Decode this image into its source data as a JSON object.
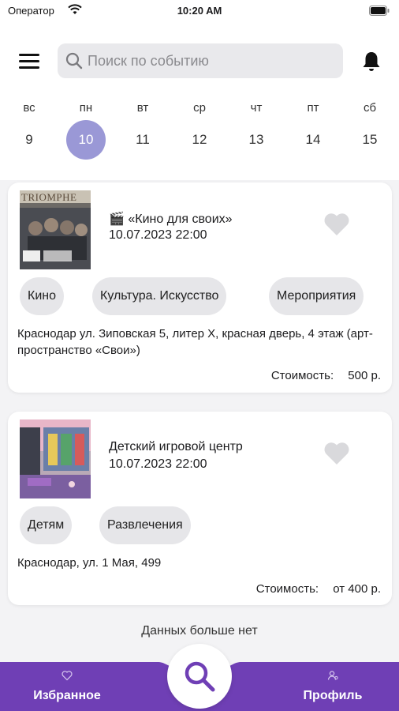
{
  "status_bar": {
    "carrier": "Оператор",
    "time": "10:20 AM"
  },
  "search": {
    "placeholder": "Поиск по событию"
  },
  "week": [
    {
      "name": "вс",
      "num": "9",
      "active": false
    },
    {
      "name": "пн",
      "num": "10",
      "active": true
    },
    {
      "name": "вт",
      "num": "11",
      "active": false
    },
    {
      "name": "ср",
      "num": "12",
      "active": false
    },
    {
      "name": "чт",
      "num": "13",
      "active": false
    },
    {
      "name": "пт",
      "num": "14",
      "active": false
    },
    {
      "name": "сб",
      "num": "15",
      "active": false
    }
  ],
  "events": [
    {
      "title": "🎬 «Кино для своих»",
      "date": "10.07.2023 22:00",
      "thumb_text": "TRIOMPHE",
      "tags": [
        "Кино",
        "Культура. Искусство",
        "Мероприятия"
      ],
      "address": "Краснодар ул. Зиповская 5, литер Х, красная дверь, 4 этаж (арт-пространство «Свои»)",
      "price_label": "Стоимость:",
      "price_value": "500 р."
    },
    {
      "title": "Детский игровой центр",
      "date": "10.07.2023 22:00",
      "tags": [
        "Детям",
        "Развлечения"
      ],
      "address": "Краснодар, ул. 1 Мая, 499",
      "price_label": "Стоимость:",
      "price_value": "от 400 р."
    }
  ],
  "no_more_text": "Данных больше нет",
  "nav": {
    "favorites": "Избранное",
    "profile": "Профиль"
  },
  "colors": {
    "accent": "#6f3fb5",
    "active_day": "#9a98d6",
    "heart": "#d9d9dc"
  },
  "icons": [
    "wifi-icon",
    "battery-icon",
    "menu-icon",
    "search-icon",
    "bell-icon",
    "heart-icon",
    "profile-icon"
  ]
}
